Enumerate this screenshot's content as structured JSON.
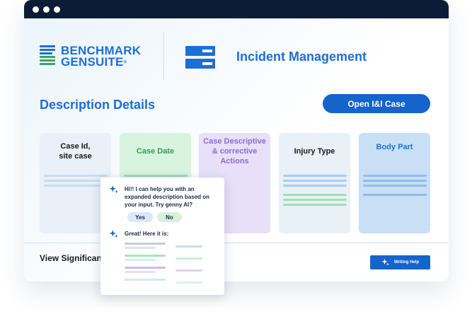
{
  "logo": {
    "line1": "BENCHMARK",
    "line2": "GENSUITE",
    "mark": "®"
  },
  "header": {
    "title": "Incident Management",
    "icon": "incident-management-icon"
  },
  "section": {
    "title": "Description Details",
    "open_button": "Open I&I Case"
  },
  "cards": [
    {
      "title": "Case Id,\nsite case",
      "bg": "#e9f0f8",
      "title_color": "#1a1a1a"
    },
    {
      "title": "Case Date",
      "bg": "#d8f3de",
      "title_color": "#2f9e55"
    },
    {
      "title": "Case Descriptive & corrective Actions",
      "bg": "#e7e0f8",
      "title_color": "#8d6ad6"
    },
    {
      "title": "Injury Type",
      "bg": "#e9f0f8",
      "title_color": "#1a1a1a"
    },
    {
      "title": "Body Part",
      "bg": "#c9dff5",
      "title_color": "#1b6fd6"
    }
  ],
  "footer": {
    "view_label": "View Significant",
    "writing_button": "Writing Help"
  },
  "popup": {
    "message": "Hi!! I can help you with an expanded description based on your input. Try genny AI?",
    "yes": "Yes",
    "no": "No",
    "response": "Great! Here it is:"
  },
  "colors": {
    "brand_blue": "#1b6fd6",
    "titlebar": "#0d1c36",
    "button_blue": "#1464cc",
    "line_blue": "#a9cdf0",
    "line_green": "#9fe0b1",
    "line_purple": "#c9b8f0",
    "line_gray": "#d5d8de"
  }
}
